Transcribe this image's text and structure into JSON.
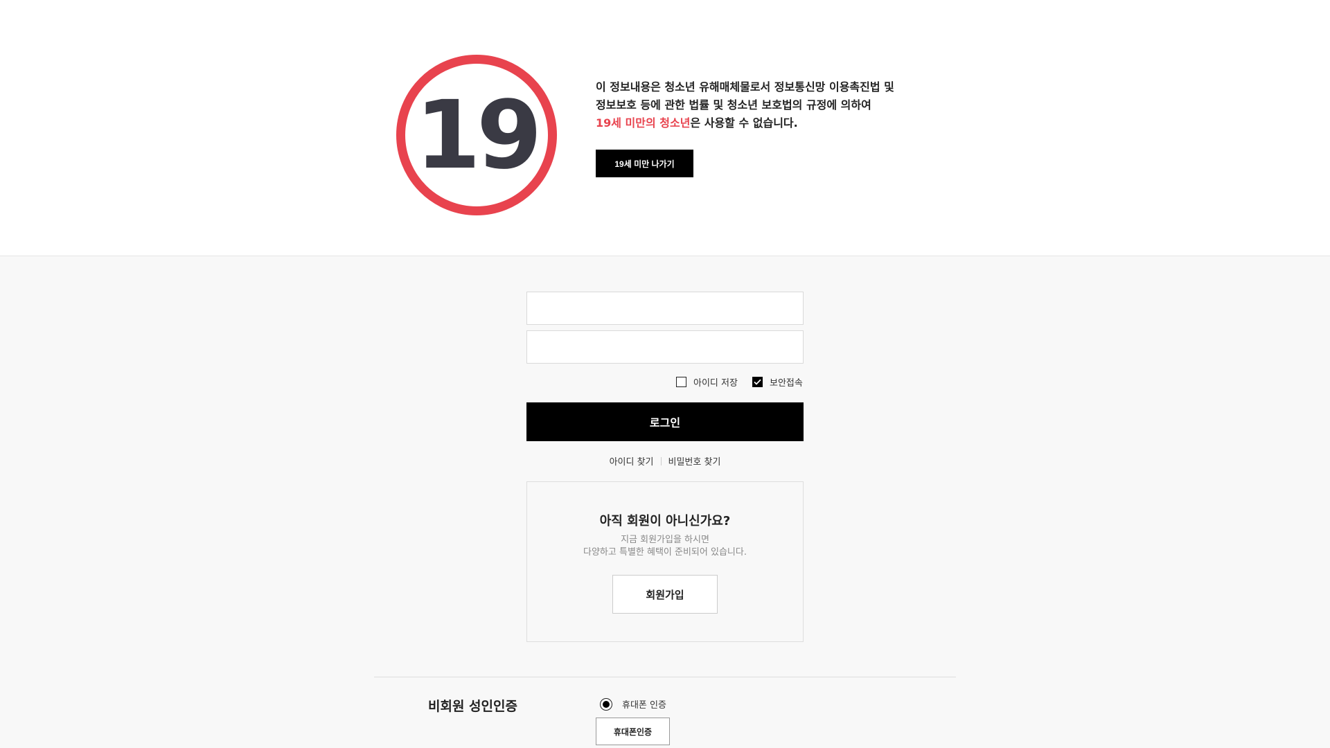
{
  "notice": {
    "badge_text": "19",
    "line1": "이 정보내용은 청소년 유해매체물로서 정보통신망 이용촉진법 및",
    "line2": "정보보호 등에 관한 법률 및 청소년 보호법의 규정에 의하여",
    "line3_highlight": "19세 미만의 청소년",
    "line3_rest": "은 사용할 수 없습니다.",
    "exit_button": "19세 미만 나가기",
    "highlight_color": "#e8434e"
  },
  "login": {
    "id_value": "",
    "pw_value": "",
    "save_id_label": "아이디 저장",
    "save_id_checked": false,
    "secure_label": "보안접속",
    "secure_checked": true,
    "login_button": "로그인",
    "find_id": "아이디 찾기",
    "find_pw": "비밀번호 찾기"
  },
  "join": {
    "title": "아직 회원이 아니신가요?",
    "desc1": "지금 회원가입을 하시면",
    "desc2": "다양하고 특별한 혜택이 준비되어 있습니다.",
    "button": "회원가입"
  },
  "guest": {
    "title": "비회원 성인인증",
    "radio_label": "휴대폰 인증",
    "radio_selected": true,
    "button": "휴대폰인증"
  }
}
